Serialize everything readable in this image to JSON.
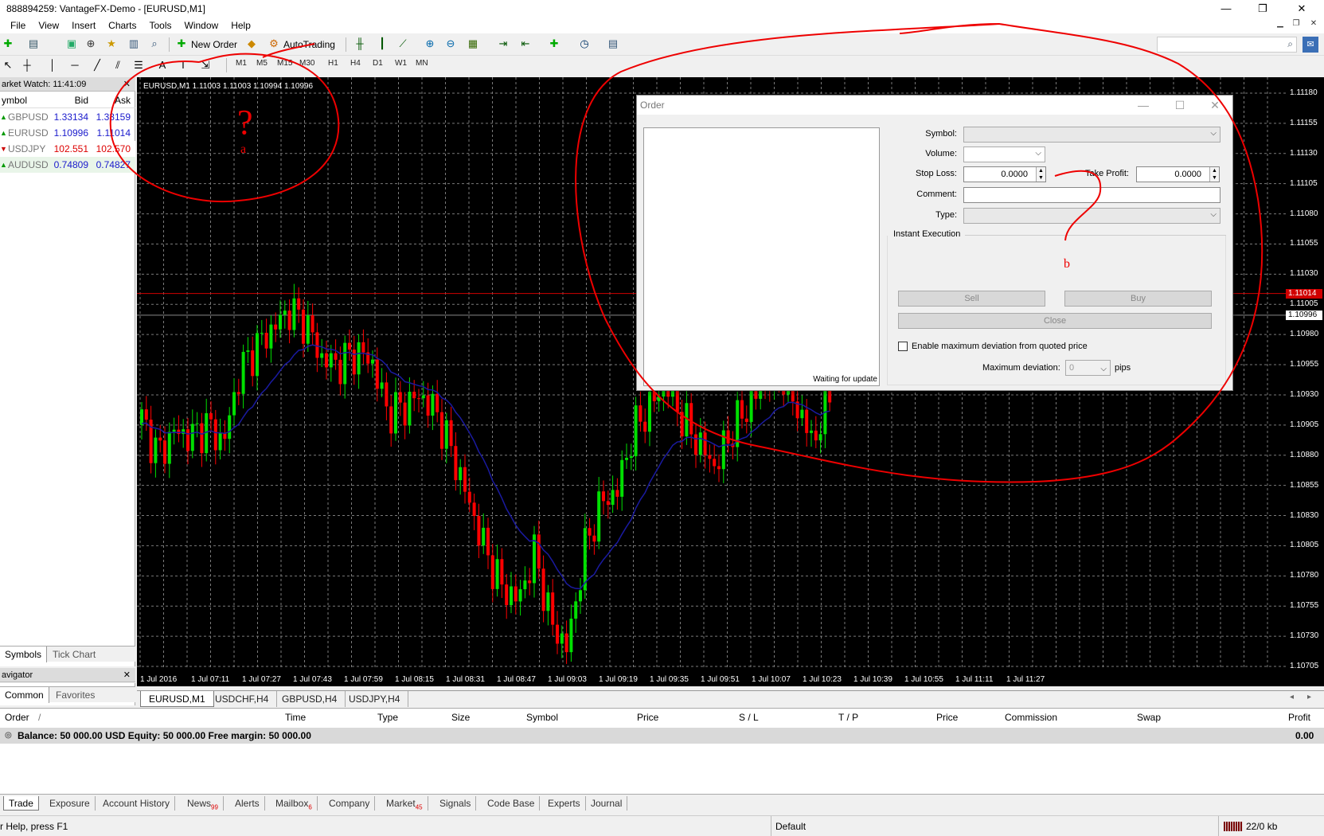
{
  "window": {
    "title": "888894259: VantageFX-Demo - [EURUSD,M1]",
    "minimize": "—",
    "restore": "❐",
    "close": "✕"
  },
  "menu": [
    "File",
    "View",
    "Insert",
    "Charts",
    "Tools",
    "Window",
    "Help"
  ],
  "toolbar": {
    "new_order": "New Order",
    "autotrading": "AutoTrading",
    "timeframes": [
      "M1",
      "M5",
      "M15",
      "M30",
      "H1",
      "H4",
      "D1",
      "W1",
      "MN"
    ]
  },
  "market_watch": {
    "title": "arket Watch: 11:41:09",
    "columns": [
      "ymbol",
      "Bid",
      "Ask"
    ],
    "rows": [
      {
        "symbol": "GBPUSD",
        "bid": "1.33134",
        "ask": "1.33159"
      },
      {
        "symbol": "EURUSD",
        "bid": "1.10996",
        "ask": "1.11014"
      },
      {
        "symbol": "USDJPY",
        "bid": "102.551",
        "ask": "102.570"
      },
      {
        "symbol": "AUDUSD",
        "bid": "0.74809",
        "ask": "0.74827"
      }
    ],
    "tabs": [
      "Symbols",
      "Tick Chart"
    ]
  },
  "navigator": {
    "title": "avigator",
    "tabs": [
      "Common",
      "Favorites"
    ]
  },
  "chart": {
    "info": "EURUSD,M1  1.11003 1.11003 1.10994 1.10996",
    "price_labels": [
      "1.11180",
      "1.11155",
      "1.11130",
      "1.11105",
      "1.11080",
      "1.11055",
      "1.11030",
      "1.11005",
      "1.10980",
      "1.10955",
      "1.10930",
      "1.10905",
      "1.10880",
      "1.10855",
      "1.10830",
      "1.10805",
      "1.10780",
      "1.10755",
      "1.10730",
      "1.10705"
    ],
    "ask_tag": "1.11014",
    "bid_tag": "1.10996",
    "time_labels": [
      "1 Jul 2016",
      "1 Jul 07:11",
      "1 Jul 07:27",
      "1 Jul 07:43",
      "1 Jul 07:59",
      "1 Jul 08:15",
      "1 Jul 08:31",
      "1 Jul 08:47",
      "1 Jul 09:03",
      "1 Jul 09:19",
      "1 Jul 09:35",
      "1 Jul 09:51",
      "1 Jul 10:07",
      "1 Jul 10:23",
      "1 Jul 10:39",
      "1 Jul 10:55",
      "1 Jul 11:11",
      "1 Jul 11:27"
    ],
    "colors": {
      "bull": "#00e000",
      "bear": "#ff0000",
      "ma": "#1a1aa0",
      "grid": "#7a7a7a",
      "ask_line": "#d00000"
    }
  },
  "chart_tabs": [
    "EURUSD,M1",
    "USDCHF,H4",
    "GBPUSD,H4",
    "USDJPY,H4"
  ],
  "order_dialog": {
    "title": "Order",
    "labels": {
      "symbol": "Symbol:",
      "volume": "Volume:",
      "stop_loss": "Stop Loss:",
      "take_profit": "Take Profit:",
      "comment": "Comment:",
      "type": "Type:"
    },
    "stop_loss_value": "0.0000",
    "take_profit_value": "0.0000",
    "section": "Instant Execution",
    "sell": "Sell",
    "buy": "Buy",
    "close": "Close",
    "enable_deviation": "Enable maximum deviation from quoted price",
    "max_deviation_label": "Maximum deviation:",
    "max_deviation_value": "0",
    "pips": "pips",
    "waiting": "Waiting for update"
  },
  "terminal": {
    "columns": [
      "Order",
      "/",
      "Time",
      "Type",
      "Size",
      "Symbol",
      "Price",
      "S / L",
      "T / P",
      "Price",
      "Commission",
      "Swap",
      "Profit"
    ],
    "balance": "Balance: 50 000.00 USD  Equity: 50 000.00  Free margin: 50 000.00",
    "profit_total": "0.00",
    "tabs": [
      {
        "label": "Trade",
        "badge": ""
      },
      {
        "label": "Exposure",
        "badge": ""
      },
      {
        "label": "Account History",
        "badge": ""
      },
      {
        "label": "News",
        "badge": "99"
      },
      {
        "label": "Alerts",
        "badge": ""
      },
      {
        "label": "Mailbox",
        "badge": "6"
      },
      {
        "label": "Company",
        "badge": ""
      },
      {
        "label": "Market",
        "badge": "45"
      },
      {
        "label": "Signals",
        "badge": ""
      },
      {
        "label": "Code Base",
        "badge": ""
      },
      {
        "label": "Experts",
        "badge": ""
      },
      {
        "label": "Journal",
        "badge": ""
      }
    ]
  },
  "status": {
    "help": "r Help, press F1",
    "profile": "Default",
    "traffic": "22/0 kb"
  },
  "annotations": {
    "question": "?",
    "mark_a": "a",
    "mark_b": "b"
  }
}
